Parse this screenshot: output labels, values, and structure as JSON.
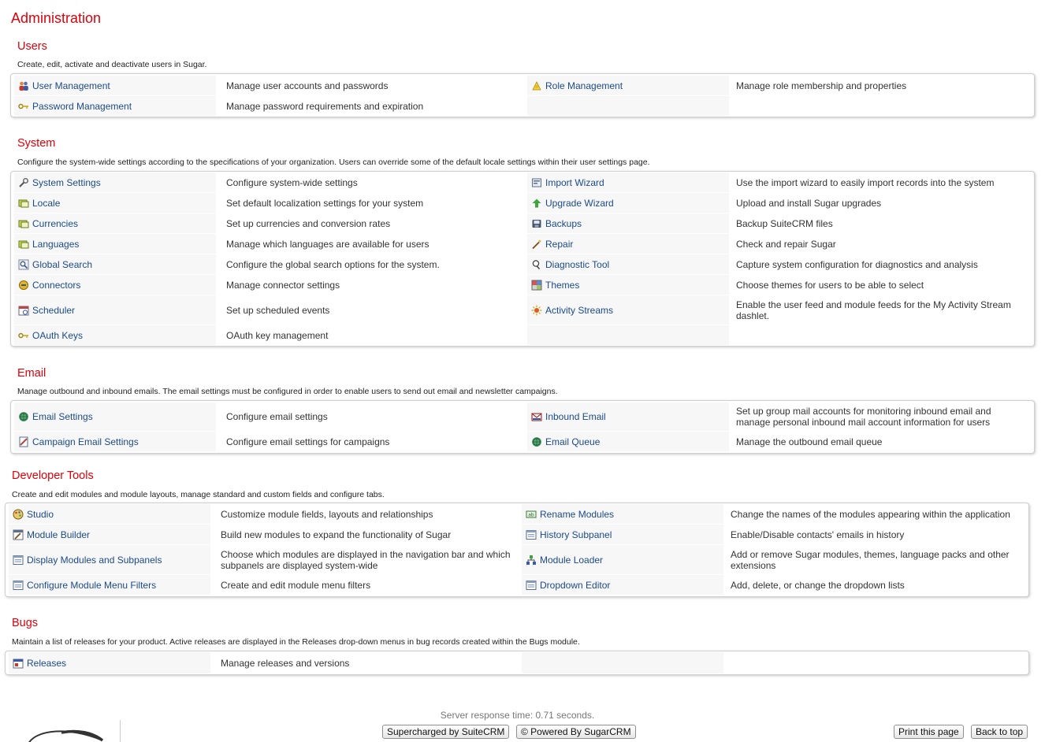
{
  "page": {
    "title": "Administration"
  },
  "sections": {
    "users": {
      "title": "Users",
      "description": "Create, edit, activate and deactivate users in Sugar.",
      "items": [
        {
          "label": "User Management",
          "desc": "Manage user accounts and passwords",
          "icon": "users-icon"
        },
        {
          "label": "Role Management",
          "desc": "Manage role membership and properties",
          "icon": "role-icon"
        },
        {
          "label": "Password Management",
          "desc": "Manage password requirements and expiration",
          "icon": "key-icon"
        }
      ]
    },
    "system": {
      "title": "System",
      "description": "Configure the system-wide settings according to the specifications of your organization. Users can override some of the default locale settings within their user settings page.",
      "items": [
        {
          "label": "System Settings",
          "desc": "Configure system-wide settings",
          "icon": "wrench-icon"
        },
        {
          "label": "Import Wizard",
          "desc": "Use the import wizard to easily import records into the system",
          "icon": "import-icon"
        },
        {
          "label": "Locale",
          "desc": "Set default localization settings for your system",
          "icon": "locale-icon"
        },
        {
          "label": "Upgrade Wizard",
          "desc": "Upload and install Sugar upgrades",
          "icon": "arrow-up-icon"
        },
        {
          "label": "Currencies",
          "desc": "Set up currencies and conversion rates",
          "icon": "currency-icon"
        },
        {
          "label": "Backups",
          "desc": "Backup SuiteCRM files",
          "icon": "backup-icon"
        },
        {
          "label": "Languages",
          "desc": "Manage which languages are available for users",
          "icon": "language-icon"
        },
        {
          "label": "Repair",
          "desc": "Check and repair Sugar",
          "icon": "repair-icon"
        },
        {
          "label": "Global Search",
          "desc": "Configure the global search options for the system.",
          "icon": "search-icon"
        },
        {
          "label": "Diagnostic Tool",
          "desc": "Capture system configuration for diagnostics and analysis",
          "icon": "diagnostic-icon"
        },
        {
          "label": "Connectors",
          "desc": "Manage connector settings",
          "icon": "connectors-icon"
        },
        {
          "label": "Themes",
          "desc": "Choose themes for users to be able to select",
          "icon": "themes-icon"
        },
        {
          "label": "Scheduler",
          "desc": "Set up scheduled events",
          "icon": "scheduler-icon"
        },
        {
          "label": "Activity Streams",
          "desc": "Enable the user feed and module feeds for the My Activity Stream dashlet.",
          "icon": "activity-streams-icon"
        },
        {
          "label": "OAuth Keys",
          "desc": "OAuth key management",
          "icon": "oauth-key-icon"
        }
      ]
    },
    "email": {
      "title": "Email",
      "description": "Manage outbound and inbound emails. The email settings must be configured in order to enable users to send out email and newsletter campaigns.",
      "items": [
        {
          "label": "Email Settings",
          "desc": "Configure email settings",
          "icon": "email-settings-icon"
        },
        {
          "label": "Inbound Email",
          "desc": "Set up group mail accounts for monitoring inbound email and manage personal inbound mail account information for users",
          "icon": "inbound-email-icon"
        },
        {
          "label": "Campaign Email Settings",
          "desc": "Configure email settings for campaigns",
          "icon": "campaign-email-icon"
        },
        {
          "label": "Email Queue",
          "desc": "Manage the outbound email queue",
          "icon": "email-queue-icon"
        }
      ]
    },
    "developer": {
      "title": "Developer Tools",
      "description": "Create and edit modules and module layouts, manage standard and custom fields and configure tabs.",
      "items": [
        {
          "label": "Studio",
          "desc": "Customize module fields, layouts and relationships",
          "icon": "studio-icon"
        },
        {
          "label": "Rename Modules",
          "desc": "Change the names of the modules appearing within the application",
          "icon": "rename-icon"
        },
        {
          "label": "Module Builder",
          "desc": "Build new modules to expand the functionality of Sugar",
          "icon": "module-builder-icon"
        },
        {
          "label": "History Subpanel",
          "desc": "Enable/Disable contacts' emails in history",
          "icon": "history-icon"
        },
        {
          "label": "Display Modules and Subpanels",
          "desc": "Choose which modules are displayed in the navigation bar and which subpanels are displayed system-wide",
          "icon": "display-modules-icon"
        },
        {
          "label": "Module Loader",
          "desc": "Add or remove Sugar modules, themes, language packs and other extensions",
          "icon": "module-loader-icon"
        },
        {
          "label": "Configure Module Menu Filters",
          "desc": "Create and edit module menu filters",
          "icon": "menu-filters-icon"
        },
        {
          "label": "Dropdown Editor",
          "desc": "Add, delete, or change the dropdown lists",
          "icon": "dropdown-icon"
        }
      ]
    },
    "bugs": {
      "title": "Bugs",
      "description": "Maintain a list of releases for your product. Active releases are displayed in the Releases drop-down menus in bug records created within the Bugs module.",
      "items": [
        {
          "label": "Releases",
          "desc": "Manage releases and versions",
          "icon": "releases-icon"
        }
      ]
    }
  },
  "footer": {
    "response_time": "Server response time: 0.71 seconds.",
    "suitecrm_btn": "Supercharged by SuiteCRM",
    "sugarcrm_btn": "© Powered By SugarCRM",
    "print_btn": "Print this page",
    "top_btn": "Back to top"
  },
  "colors": {
    "title": "#e0000a",
    "link": "#1b4a8c",
    "cell_shade": "#f7f7f7"
  }
}
